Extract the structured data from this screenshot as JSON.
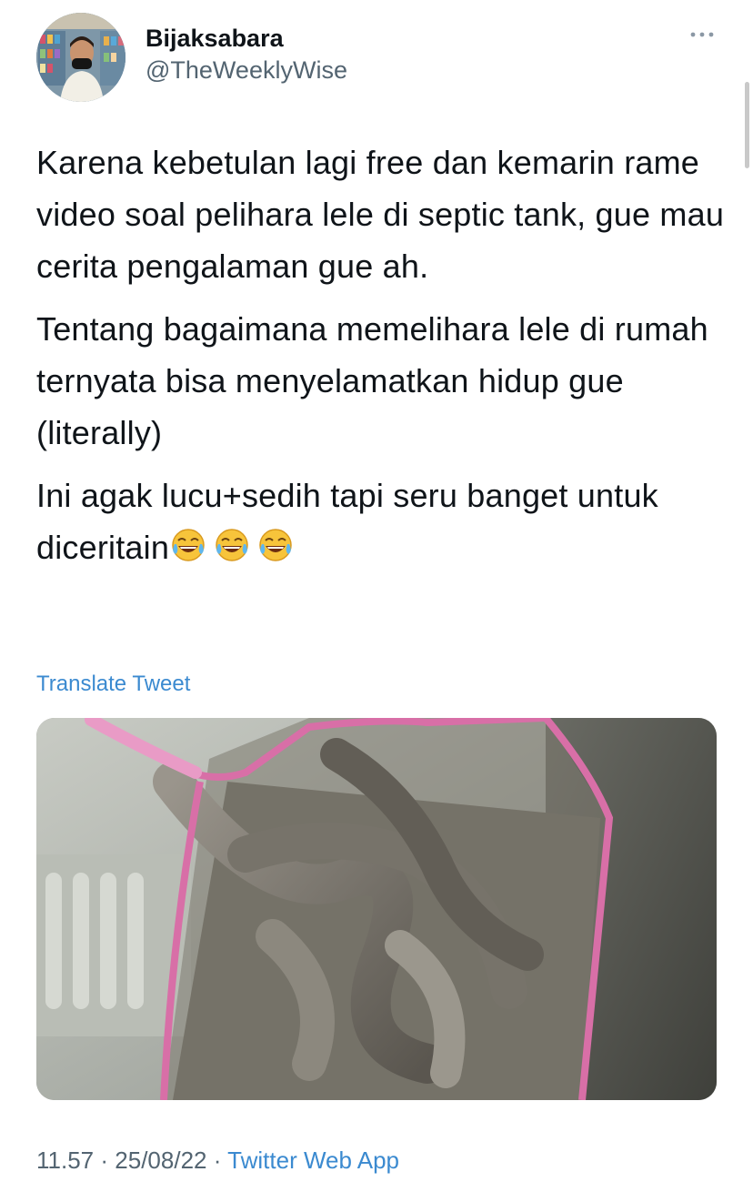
{
  "user": {
    "display_name": "Bijaksabara",
    "handle": "@TheWeeklyWise"
  },
  "tweet": {
    "paragraphs": [
      "Karena kebetulan lagi free dan kemarin rame video soal pelihara lele di septic tank, gue mau cerita pengalaman gue ah.",
      "Tentang bagaimana memelihara lele di rumah ternyata bisa menyelamatkan hidup gue (literally)",
      "Ini agak lucu+sedih tapi seru banget untuk diceritain"
    ],
    "emojis": [
      "face-with-tears-of-joy",
      "face-with-tears-of-joy",
      "face-with-tears-of-joy"
    ],
    "translate_label": "Translate Tweet"
  },
  "media": {
    "icon": "catfish-in-net-photo"
  },
  "meta": {
    "time": "11.57",
    "separator": "·",
    "date": "25/08/22",
    "source": "Twitter Web App"
  },
  "icons": {
    "more": "more-options-icon"
  },
  "colors": {
    "link": "#3b8ad0",
    "secondary": "#536471",
    "text": "#0f1419"
  }
}
